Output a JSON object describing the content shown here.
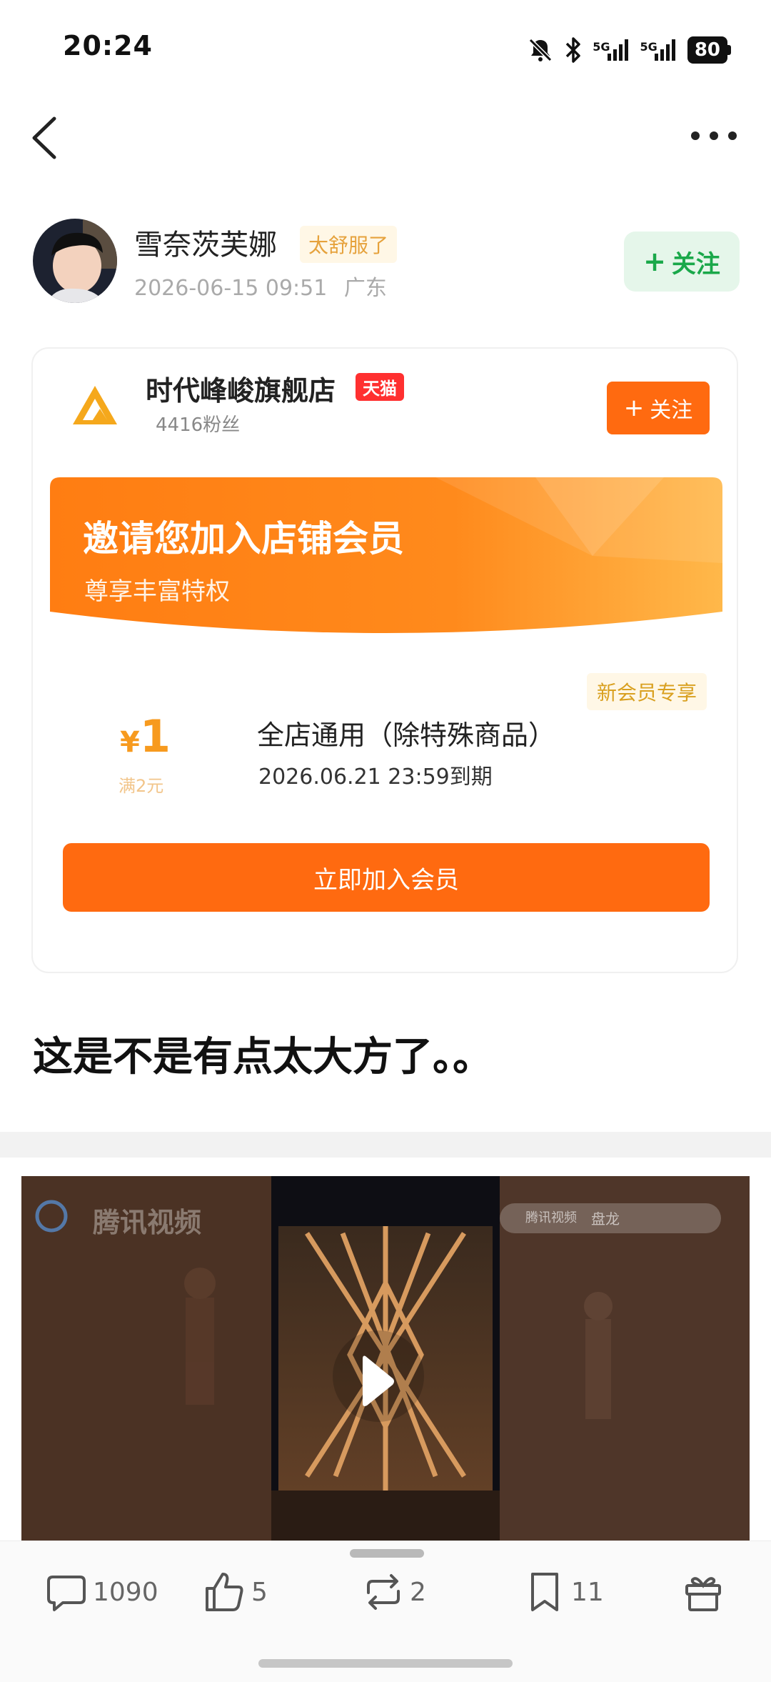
{
  "status": {
    "time": "20:24",
    "battery": "80",
    "signal1": "5G",
    "signal2": "5G"
  },
  "author": {
    "name": "雪奈茨芙娜",
    "tag": "太舒服了",
    "timestamp": "2026-06-15 09:51",
    "location": "广东",
    "follow_label": "关注"
  },
  "shop_card": {
    "shop_name": "时代峰峻旗舰店",
    "badge": "天猫",
    "fans": "4416粉丝",
    "follow_label": "关注",
    "banner_title": "邀请您加入店铺会员",
    "banner_subtitle": "尊享丰富特权",
    "new_member_tag": "新会员专享",
    "coupon_symbol": "¥",
    "coupon_amount": "1",
    "coupon_condition": "满2元",
    "coupon_title": "全店通用（除特殊商品）",
    "coupon_expiry": "2026.06.21 23:59到期",
    "join_button": "立即加入会员"
  },
  "post_text": "这是不是有点太大方了。。",
  "video": {
    "watermark": "腾讯视频",
    "mini_brand": "腾讯视频",
    "mini_title": "盘龙"
  },
  "actions": {
    "comments": "1090",
    "likes": "5",
    "reposts": "2",
    "favorites": "11"
  },
  "colors": {
    "accent_orange": "#ff6a10",
    "follow_green": "#1aa84a",
    "follow_green_bg": "#e5f6ea",
    "tag_gold": "#e6a23c"
  },
  "icons": [
    "back-icon",
    "more-icon",
    "bell-off-icon",
    "bluetooth-icon",
    "signal-icon",
    "battery-icon",
    "play-icon",
    "comment-icon",
    "like-icon",
    "repost-icon",
    "bookmark-icon",
    "gift-icon"
  ]
}
